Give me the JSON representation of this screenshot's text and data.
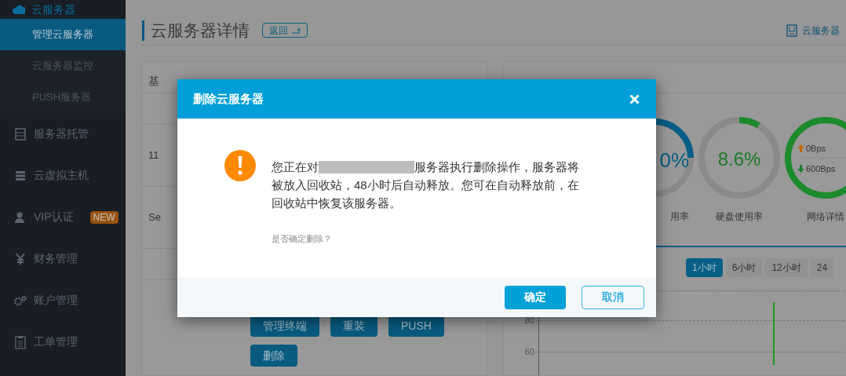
{
  "sidebar": {
    "section": "云服务器",
    "items": [
      {
        "label": "管理云服务器",
        "kind": "sub",
        "selected": true
      },
      {
        "label": "云服务器监控",
        "kind": "sub",
        "selected": false
      },
      {
        "label": "PUSH服务器",
        "kind": "sub",
        "selected": false
      },
      {
        "label": "服务器托管",
        "kind": "main",
        "selected": false
      },
      {
        "label": "云虚拟主机",
        "kind": "main",
        "selected": false
      },
      {
        "label": "VIP认证",
        "kind": "main",
        "badge": "NEW",
        "selected": false
      },
      {
        "label": "财务管理",
        "kind": "main",
        "selected": false
      },
      {
        "label": "账户管理",
        "kind": "main",
        "selected": false
      },
      {
        "label": "工单管理",
        "kind": "main",
        "selected": false
      }
    ]
  },
  "page": {
    "title": "云服务器详情",
    "back_button": "返回",
    "help_link": "云服务器"
  },
  "basic_panel": {
    "title": "基",
    "row_values": [
      "11",
      "Se"
    ],
    "actions": [
      "管理终端",
      "重装",
      "PUSH",
      "删除"
    ]
  },
  "monitor_panel": {
    "gauges": [
      {
        "kind": "partial",
        "value": "0%",
        "label": "用率"
      },
      {
        "kind": "ring",
        "value": "8.6%",
        "label": "硬盘使用率",
        "level": 0.086
      },
      {
        "kind": "network",
        "up": "0Bps",
        "down": "600Bps",
        "label": "网络详情"
      }
    ],
    "ranges": [
      {
        "label": "1小时",
        "selected": true
      },
      {
        "label": "6小时",
        "selected": false
      },
      {
        "label": "12小时",
        "selected": false
      },
      {
        "label": "24",
        "selected": false
      }
    ],
    "y_ticks": [
      "80",
      "60"
    ]
  },
  "dialog": {
    "title": "删除云服务器",
    "message_before": "您正在对",
    "message_after": "服务器执行删除操作，服务器将被放入回收站，48小时后自动释放。您可在自动释放前，在回收站中恢复该服务器。",
    "question": "是否确定删除？",
    "confirm": "确定",
    "cancel": "取消"
  }
}
